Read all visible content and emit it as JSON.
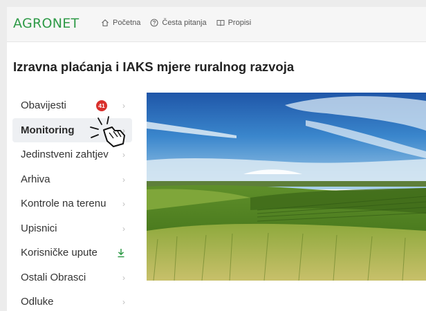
{
  "header": {
    "logo": "AGRONET",
    "nav": [
      {
        "label": "Početna",
        "icon": "home-icon"
      },
      {
        "label": "Česta pitanja",
        "icon": "help-circle-icon"
      },
      {
        "label": "Propisi",
        "icon": "book-icon"
      }
    ]
  },
  "page_title": "Izravna plaćanja i IAKS mjere ruralnog razvoja",
  "sidebar": {
    "items": [
      {
        "label": "Obavijesti",
        "badge": "41",
        "trailing_icon": "chevron-right-icon"
      },
      {
        "label": "Monitoring",
        "active": true,
        "trailing_icon": "chevron-right-icon"
      },
      {
        "label": "Jedinstveni zahtjev",
        "trailing_icon": "chevron-right-icon"
      },
      {
        "label": "Arhiva",
        "trailing_icon": "chevron-right-icon"
      },
      {
        "label": "Kontrole na terenu",
        "trailing_icon": "chevron-right-icon"
      },
      {
        "label": "Upisnici",
        "trailing_icon": "chevron-right-icon"
      },
      {
        "label": "Korisničke upute",
        "trailing_icon": "download-icon"
      },
      {
        "label": "Ostali Obrasci",
        "trailing_icon": "chevron-right-icon"
      },
      {
        "label": "Odluke",
        "trailing_icon": "chevron-right-icon"
      }
    ]
  },
  "colors": {
    "brand": "#2e9a47",
    "badge": "#d9302c",
    "active_bg": "#eef0f3"
  }
}
